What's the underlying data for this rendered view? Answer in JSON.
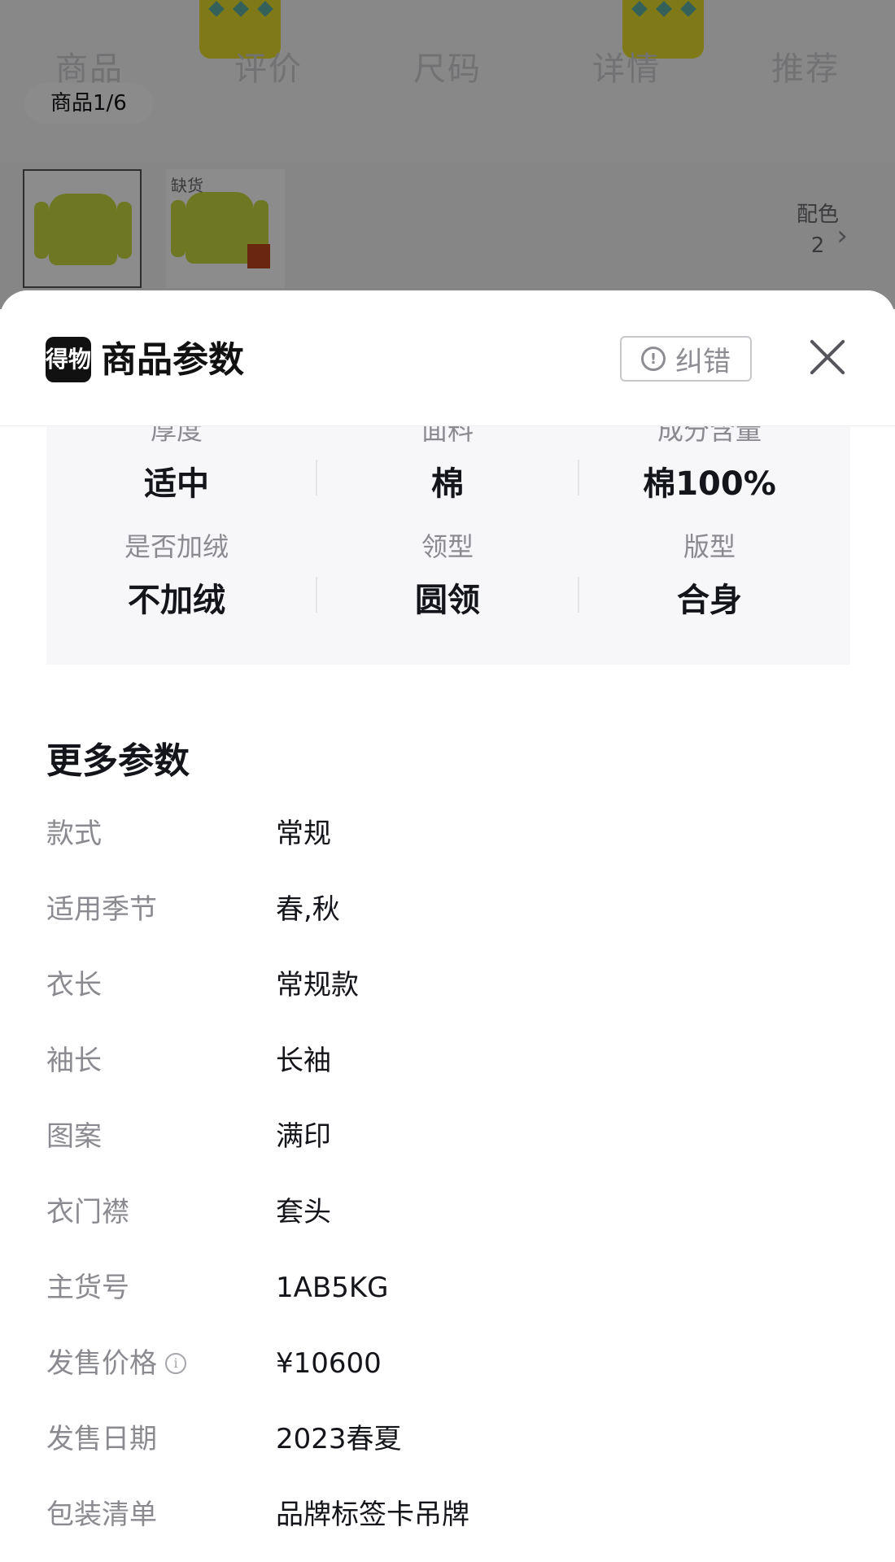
{
  "background_page": {
    "tabs": [
      "商品",
      "评价",
      "尺码",
      "详情",
      "推荐"
    ],
    "gallery_counter": "商品1/6",
    "thumbnail_badge": "缺货",
    "colorway_label": "配色",
    "colorway_count": "2"
  },
  "sheet": {
    "brand_logo_text": "得物",
    "title": "商品参数",
    "report_label": "纠错"
  },
  "key_params": [
    {
      "label": "厚度",
      "value": "适中"
    },
    {
      "label": "面料",
      "value": "棉"
    },
    {
      "label": "成分含量",
      "value": "棉100%"
    },
    {
      "label": "是否加绒",
      "value": "不加绒"
    },
    {
      "label": "领型",
      "value": "圆领"
    },
    {
      "label": "版型",
      "value": "合身"
    }
  ],
  "more_params": {
    "title": "更多参数",
    "rows": [
      {
        "label": "款式",
        "value": "常规"
      },
      {
        "label": "适用季节",
        "value": "春,秋"
      },
      {
        "label": "衣长",
        "value": "常规款"
      },
      {
        "label": "袖长",
        "value": "长袖"
      },
      {
        "label": "图案",
        "value": "满印"
      },
      {
        "label": "衣门襟",
        "value": "套头"
      },
      {
        "label": "主货号",
        "value": "1AB5KG"
      },
      {
        "label": "发售价格",
        "value": "¥10600"
      },
      {
        "label": "发售日期",
        "value": "2023春夏"
      },
      {
        "label": "包装清单",
        "value": "品牌标签卡吊牌"
      }
    ]
  },
  "colors": {
    "accent_text": "#14151a",
    "muted_text": "#8a8a90",
    "panel_bg": "#f7f7f9",
    "garment_yellow": "#e8df2a"
  }
}
